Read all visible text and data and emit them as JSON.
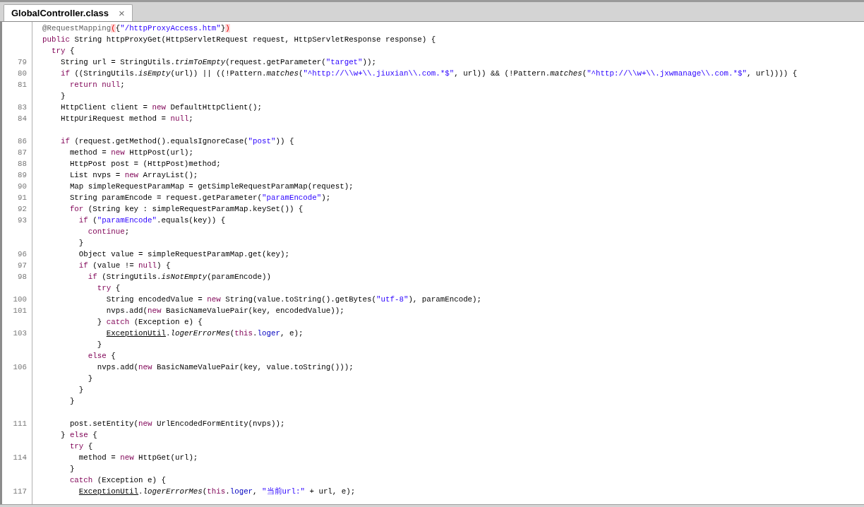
{
  "tabs": [
    {
      "label": "GlobalController.class",
      "close": "×",
      "selected": true
    }
  ],
  "editor": {
    "lines": [
      {
        "kind": "code",
        "segments": [
          {
            "kind": "annotation",
            "text": "@RequestMapping"
          },
          {
            "kind": "match",
            "text": "("
          },
          {
            "kind": "plain",
            "text": "{"
          },
          {
            "kind": "string",
            "text": "\"/httpProxyAccess.htm\""
          },
          {
            "kind": "plain",
            "text": "}"
          },
          {
            "kind": "match",
            "text": ")"
          }
        ]
      },
      {
        "kind": "code",
        "segments": [
          {
            "kind": "keyword",
            "text": "public"
          },
          {
            "kind": "plain",
            "text": " String httpProxyGet(HttpServletRequest request, HttpServletResponse response) {"
          }
        ]
      },
      {
        "kind": "code",
        "segments": [
          {
            "kind": "keyword",
            "text": "  try"
          },
          {
            "kind": "plain",
            "text": " {"
          }
        ]
      },
      {
        "kind": "code",
        "number": "79",
        "segments": [
          {
            "kind": "plain",
            "text": "    String url = StringUtils."
          },
          {
            "kind": "italic",
            "text": "trimToEmpty"
          },
          {
            "kind": "plain",
            "text": "(request.getParameter("
          },
          {
            "kind": "string",
            "text": "\"target\""
          },
          {
            "kind": "plain",
            "text": "));"
          }
        ]
      },
      {
        "kind": "code",
        "number": "80",
        "segments": [
          {
            "kind": "keyword",
            "text": "    if"
          },
          {
            "kind": "plain",
            "text": " ((StringUtils."
          },
          {
            "kind": "italic",
            "text": "isEmpty"
          },
          {
            "kind": "plain",
            "text": "(url)) || ((!Pattern."
          },
          {
            "kind": "italic",
            "text": "matches"
          },
          {
            "kind": "plain",
            "text": "("
          },
          {
            "kind": "string",
            "text": "\"^http://\\\\w+\\\\.jiuxian\\\\.com.*$\""
          },
          {
            "kind": "plain",
            "text": ", url)) && (!Pattern."
          },
          {
            "kind": "italic",
            "text": "matches"
          },
          {
            "kind": "plain",
            "text": "("
          },
          {
            "kind": "string",
            "text": "\"^http://\\\\w+\\\\.jxwmanage\\\\.com.*$\""
          },
          {
            "kind": "plain",
            "text": ", url)))) {"
          }
        ]
      },
      {
        "kind": "code",
        "number": "81",
        "segments": [
          {
            "kind": "keyword",
            "text": "      return null"
          },
          {
            "kind": "plain",
            "text": ";"
          }
        ]
      },
      {
        "kind": "code",
        "segments": [
          {
            "kind": "plain",
            "text": "    }"
          }
        ]
      },
      {
        "kind": "code",
        "number": "83",
        "segments": [
          {
            "kind": "plain",
            "text": "    HttpClient client = "
          },
          {
            "kind": "keyword",
            "text": "new"
          },
          {
            "kind": "plain",
            "text": " DefaultHttpClient();"
          }
        ]
      },
      {
        "kind": "code",
        "number": "84",
        "segments": [
          {
            "kind": "plain",
            "text": "    HttpUriRequest method = "
          },
          {
            "kind": "keyword",
            "text": "null"
          },
          {
            "kind": "plain",
            "text": ";"
          }
        ]
      },
      {
        "kind": "blank"
      },
      {
        "kind": "code",
        "number": "86",
        "segments": [
          {
            "kind": "keyword",
            "text": "    if"
          },
          {
            "kind": "plain",
            "text": " (request.getMethod().equalsIgnoreCase("
          },
          {
            "kind": "string",
            "text": "\"post\""
          },
          {
            "kind": "plain",
            "text": ")) {"
          }
        ]
      },
      {
        "kind": "code",
        "number": "87",
        "segments": [
          {
            "kind": "plain",
            "text": "      method = "
          },
          {
            "kind": "keyword",
            "text": "new"
          },
          {
            "kind": "plain",
            "text": " HttpPost(url);"
          }
        ]
      },
      {
        "kind": "code",
        "number": "88",
        "segments": [
          {
            "kind": "plain",
            "text": "      HttpPost post = (HttpPost)method;"
          }
        ]
      },
      {
        "kind": "code",
        "number": "89",
        "segments": [
          {
            "kind": "plain",
            "text": "      List nvps = "
          },
          {
            "kind": "keyword",
            "text": "new"
          },
          {
            "kind": "plain",
            "text": " ArrayList();"
          }
        ]
      },
      {
        "kind": "code",
        "number": "90",
        "segments": [
          {
            "kind": "plain",
            "text": "      Map simpleRequestParamMap = getSimpleRequestParamMap(request);"
          }
        ]
      },
      {
        "kind": "code",
        "number": "91",
        "segments": [
          {
            "kind": "plain",
            "text": "      String paramEncode = request.getParameter("
          },
          {
            "kind": "string",
            "text": "\"paramEncode\""
          },
          {
            "kind": "plain",
            "text": ");"
          }
        ]
      },
      {
        "kind": "code",
        "number": "92",
        "segments": [
          {
            "kind": "keyword",
            "text": "      for"
          },
          {
            "kind": "plain",
            "text": " (String key : simpleRequestParamMap.keySet()) {"
          }
        ]
      },
      {
        "kind": "code",
        "number": "93",
        "segments": [
          {
            "kind": "keyword",
            "text": "        if"
          },
          {
            "kind": "plain",
            "text": " ("
          },
          {
            "kind": "string",
            "text": "\"paramEncode\""
          },
          {
            "kind": "plain",
            "text": ".equals(key)) {"
          }
        ]
      },
      {
        "kind": "code",
        "segments": [
          {
            "kind": "keyword",
            "text": "          continue"
          },
          {
            "kind": "plain",
            "text": ";"
          }
        ]
      },
      {
        "kind": "code",
        "segments": [
          {
            "kind": "plain",
            "text": "        }"
          }
        ]
      },
      {
        "kind": "code",
        "number": "96",
        "segments": [
          {
            "kind": "plain",
            "text": "        Object value = simpleRequestParamMap.get(key);"
          }
        ]
      },
      {
        "kind": "code",
        "number": "97",
        "segments": [
          {
            "kind": "keyword",
            "text": "        if"
          },
          {
            "kind": "plain",
            "text": " (value != "
          },
          {
            "kind": "keyword",
            "text": "null"
          },
          {
            "kind": "plain",
            "text": ") {"
          }
        ]
      },
      {
        "kind": "code",
        "number": "98",
        "segments": [
          {
            "kind": "keyword",
            "text": "          if"
          },
          {
            "kind": "plain",
            "text": " (StringUtils."
          },
          {
            "kind": "italic",
            "text": "isNotEmpty"
          },
          {
            "kind": "plain",
            "text": "(paramEncode))"
          }
        ]
      },
      {
        "kind": "code",
        "segments": [
          {
            "kind": "keyword",
            "text": "            try"
          },
          {
            "kind": "plain",
            "text": " {"
          }
        ]
      },
      {
        "kind": "code",
        "number": "100",
        "segments": [
          {
            "kind": "plain",
            "text": "              String encodedValue = "
          },
          {
            "kind": "keyword",
            "text": "new"
          },
          {
            "kind": "plain",
            "text": " String(value.toString().getBytes("
          },
          {
            "kind": "string",
            "text": "\"utf-8\""
          },
          {
            "kind": "plain",
            "text": "), paramEncode);"
          }
        ]
      },
      {
        "kind": "code",
        "number": "101",
        "segments": [
          {
            "kind": "plain",
            "text": "              nvps.add("
          },
          {
            "kind": "keyword",
            "text": "new"
          },
          {
            "kind": "plain",
            "text": " BasicNameValuePair(key, encodedValue));"
          }
        ]
      },
      {
        "kind": "code",
        "segments": [
          {
            "kind": "plain",
            "text": "            } "
          },
          {
            "kind": "keyword",
            "text": "catch"
          },
          {
            "kind": "plain",
            "text": " (Exception e) {"
          }
        ]
      },
      {
        "kind": "code",
        "number": "103",
        "segments": [
          {
            "kind": "underline",
            "text": "              ExceptionUtil"
          },
          {
            "kind": "plain",
            "text": "."
          },
          {
            "kind": "italic",
            "text": "logerErrorMes"
          },
          {
            "kind": "plain",
            "text": "("
          },
          {
            "kind": "keyword",
            "text": "this"
          },
          {
            "kind": "plain",
            "text": "."
          },
          {
            "kind": "field",
            "text": "loger"
          },
          {
            "kind": "plain",
            "text": ", e);"
          }
        ]
      },
      {
        "kind": "code",
        "segments": [
          {
            "kind": "plain",
            "text": "            }"
          }
        ]
      },
      {
        "kind": "code",
        "segments": [
          {
            "kind": "keyword",
            "text": "          else"
          },
          {
            "kind": "plain",
            "text": " {"
          }
        ]
      },
      {
        "kind": "code",
        "number": "106",
        "segments": [
          {
            "kind": "plain",
            "text": "            nvps.add("
          },
          {
            "kind": "keyword",
            "text": "new"
          },
          {
            "kind": "plain",
            "text": " BasicNameValuePair(key, value.toString()));"
          }
        ]
      },
      {
        "kind": "code",
        "segments": [
          {
            "kind": "plain",
            "text": "          }"
          }
        ]
      },
      {
        "kind": "code",
        "segments": [
          {
            "kind": "plain",
            "text": "        }"
          }
        ]
      },
      {
        "kind": "code",
        "segments": [
          {
            "kind": "plain",
            "text": "      }"
          }
        ]
      },
      {
        "kind": "blank"
      },
      {
        "kind": "code",
        "number": "111",
        "segments": [
          {
            "kind": "plain",
            "text": "      post.setEntity("
          },
          {
            "kind": "keyword",
            "text": "new"
          },
          {
            "kind": "plain",
            "text": " UrlEncodedFormEntity(nvps));"
          }
        ]
      },
      {
        "kind": "code",
        "segments": [
          {
            "kind": "plain",
            "text": "    } "
          },
          {
            "kind": "keyword",
            "text": "else"
          },
          {
            "kind": "plain",
            "text": " {"
          }
        ]
      },
      {
        "kind": "code",
        "segments": [
          {
            "kind": "keyword",
            "text": "      try"
          },
          {
            "kind": "plain",
            "text": " {"
          }
        ]
      },
      {
        "kind": "code",
        "number": "114",
        "segments": [
          {
            "kind": "plain",
            "text": "        method = "
          },
          {
            "kind": "keyword",
            "text": "new"
          },
          {
            "kind": "plain",
            "text": " HttpGet(url);"
          }
        ]
      },
      {
        "kind": "code",
        "segments": [
          {
            "kind": "plain",
            "text": "      }"
          }
        ]
      },
      {
        "kind": "code",
        "segments": [
          {
            "kind": "keyword",
            "text": "      catch"
          },
          {
            "kind": "plain",
            "text": " (Exception e) {"
          }
        ]
      },
      {
        "kind": "code",
        "number": "117",
        "segments": [
          {
            "kind": "underline",
            "text": "        ExceptionUtil"
          },
          {
            "kind": "plain",
            "text": "."
          },
          {
            "kind": "italic",
            "text": "logerErrorMes"
          },
          {
            "kind": "plain",
            "text": "("
          },
          {
            "kind": "keyword",
            "text": "this"
          },
          {
            "kind": "plain",
            "text": "."
          },
          {
            "kind": "field",
            "text": "loger"
          },
          {
            "kind": "plain",
            "text": ", "
          },
          {
            "kind": "string",
            "text": "\"当前url:\""
          },
          {
            "kind": "plain",
            "text": " + url, e);"
          }
        ]
      }
    ]
  }
}
